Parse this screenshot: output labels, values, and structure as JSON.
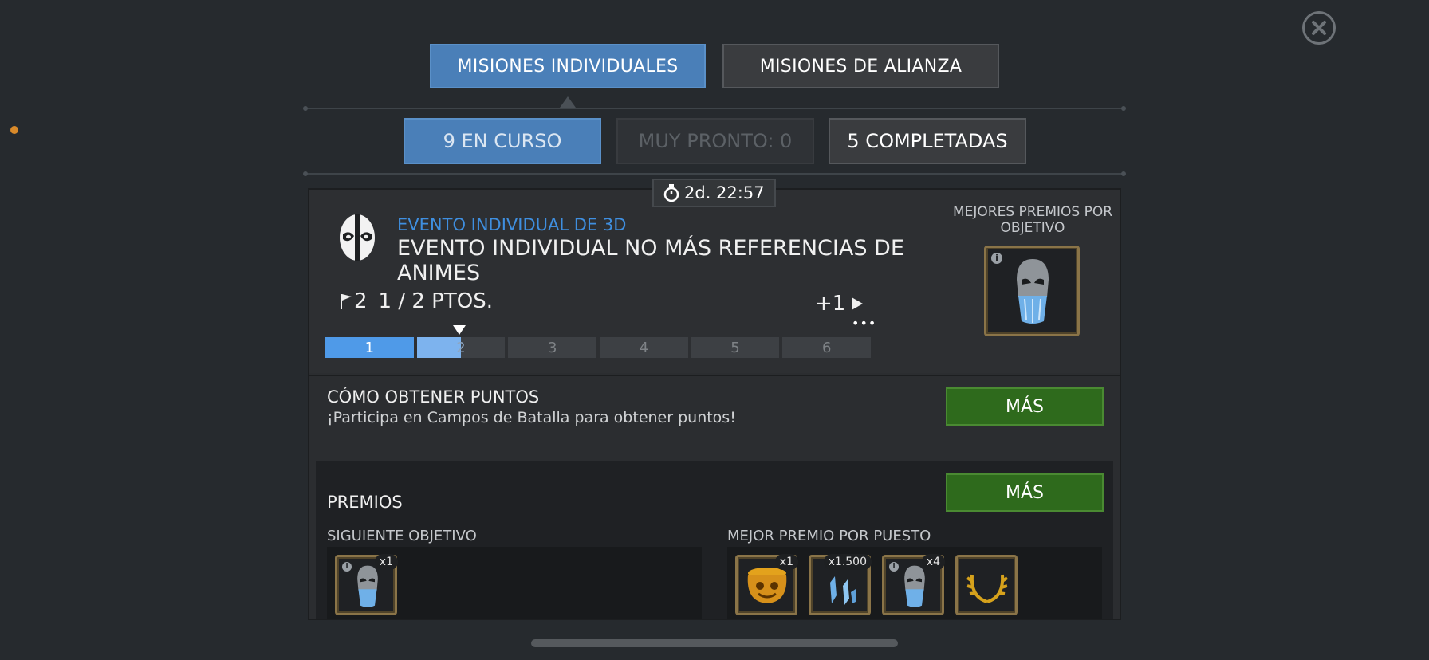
{
  "top_tabs": {
    "individual": "MISIONES INDIVIDUALES",
    "alliance": "MISIONES DE ALIANZA"
  },
  "sub_tabs": {
    "in_progress": "9 EN CURSO",
    "coming_soon": "MUY PRONTO: 0",
    "completed": "5 COMPLETADAS"
  },
  "timer": "2d. 22:57",
  "event": {
    "subtitle": "EVENTO INDIVIDUAL DE 3D",
    "title": "EVENTO INDIVIDUAL NO MÁS REFERENCIAS DE ANIMES",
    "flag_count": "2",
    "points": "1 / 2 PTOS.",
    "plus": "+1",
    "progress_labels": [
      "1",
      "2",
      "3",
      "4",
      "5",
      "6"
    ]
  },
  "best_rewards": {
    "label": "MEJORES PREMIOS POR OBJETIVO"
  },
  "how": {
    "title": "CÓMO OBTENER PUNTOS",
    "text": "¡Participa en Campos de Batalla para obtener puntos!",
    "more_label": "MÁS"
  },
  "prizes": {
    "title": "PREMIOS",
    "more_label": "MÁS",
    "next_objective_label": "SIGUIENTE OBJETIVO",
    "best_rank_label": "MEJOR PREMIO POR PUESTO",
    "next_items": [
      {
        "qty": "x1",
        "icon": "crystal-mask-icon"
      }
    ],
    "rank_items": [
      {
        "qty": "x1",
        "icon": "gold-pot-icon"
      },
      {
        "qty": "x1.500",
        "icon": "shard-icon"
      },
      {
        "qty": "x4",
        "icon": "crystal-mask-icon"
      },
      {
        "qty": "",
        "icon": "laurel-icon"
      }
    ]
  },
  "colors": {
    "accent_blue": "#4a7fb8",
    "green_button": "#2e6a1c",
    "event_subtitle": "#3f8fe0"
  }
}
